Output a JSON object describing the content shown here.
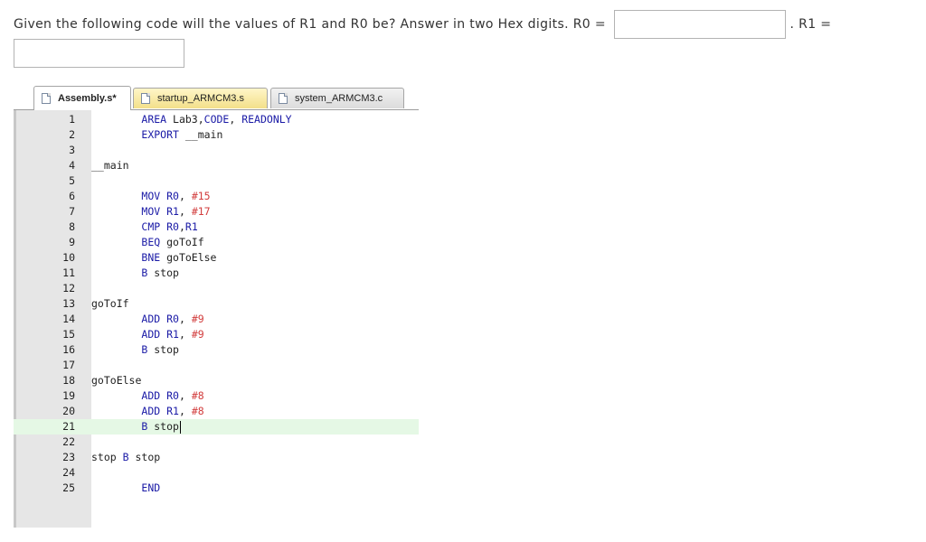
{
  "question": {
    "text_before": "Given the following code will the values of R1 and R0 be? Answer in two Hex digits. R0 =",
    "separator": ".",
    "r1_label": "R1 =",
    "r0_value": "",
    "r1_value": ""
  },
  "editor": {
    "tabs": [
      {
        "label": "Assembly.s*",
        "active": true
      },
      {
        "label": "startup_ARMCM3.s",
        "active": false
      },
      {
        "label": "system_ARMCM3.c",
        "active": false
      }
    ],
    "current_line": 21,
    "lines": [
      {
        "n": "1",
        "tokens": [
          [
            "        ",
            ""
          ],
          [
            "AREA",
            "kw"
          ],
          [
            " Lab3,",
            ""
          ],
          [
            "CODE",
            "kw"
          ],
          [
            ", ",
            ""
          ],
          [
            "READONLY",
            "kw"
          ]
        ]
      },
      {
        "n": "2",
        "tokens": [
          [
            "        ",
            ""
          ],
          [
            "EXPORT",
            "kw"
          ],
          [
            " __main",
            ""
          ]
        ]
      },
      {
        "n": "3",
        "tokens": []
      },
      {
        "n": "4",
        "tokens": [
          [
            "__main",
            ""
          ]
        ]
      },
      {
        "n": "5",
        "tokens": []
      },
      {
        "n": "6",
        "tokens": [
          [
            "        ",
            ""
          ],
          [
            "MOV",
            "kw"
          ],
          [
            " ",
            ""
          ],
          [
            "R0",
            "kw"
          ],
          [
            ", ",
            ""
          ],
          [
            "#15",
            "num"
          ]
        ]
      },
      {
        "n": "7",
        "tokens": [
          [
            "        ",
            ""
          ],
          [
            "MOV",
            "kw"
          ],
          [
            " ",
            ""
          ],
          [
            "R1",
            "kw"
          ],
          [
            ", ",
            ""
          ],
          [
            "#17",
            "num"
          ]
        ]
      },
      {
        "n": "8",
        "tokens": [
          [
            "        ",
            ""
          ],
          [
            "CMP",
            "kw"
          ],
          [
            " ",
            ""
          ],
          [
            "R0",
            "kw"
          ],
          [
            ",",
            ""
          ],
          [
            "R1",
            "kw"
          ]
        ]
      },
      {
        "n": "9",
        "tokens": [
          [
            "        ",
            ""
          ],
          [
            "BEQ",
            "kw"
          ],
          [
            " goToIf",
            ""
          ]
        ]
      },
      {
        "n": "10",
        "tokens": [
          [
            "        ",
            ""
          ],
          [
            "BNE",
            "kw"
          ],
          [
            " goToElse",
            ""
          ]
        ]
      },
      {
        "n": "11",
        "tokens": [
          [
            "        ",
            ""
          ],
          [
            "B",
            "kw"
          ],
          [
            " stop",
            ""
          ]
        ]
      },
      {
        "n": "12",
        "tokens": []
      },
      {
        "n": "13",
        "tokens": [
          [
            "goToIf",
            ""
          ]
        ]
      },
      {
        "n": "14",
        "tokens": [
          [
            "        ",
            ""
          ],
          [
            "ADD",
            "kw"
          ],
          [
            " ",
            ""
          ],
          [
            "R0",
            "kw"
          ],
          [
            ", ",
            ""
          ],
          [
            "#9",
            "num"
          ]
        ]
      },
      {
        "n": "15",
        "tokens": [
          [
            "        ",
            ""
          ],
          [
            "ADD",
            "kw"
          ],
          [
            " ",
            ""
          ],
          [
            "R1",
            "kw"
          ],
          [
            ", ",
            ""
          ],
          [
            "#9",
            "num"
          ]
        ]
      },
      {
        "n": "16",
        "tokens": [
          [
            "        ",
            ""
          ],
          [
            "B",
            "kw"
          ],
          [
            " stop",
            ""
          ]
        ]
      },
      {
        "n": "17",
        "tokens": []
      },
      {
        "n": "18",
        "tokens": [
          [
            "goToElse",
            ""
          ]
        ]
      },
      {
        "n": "19",
        "tokens": [
          [
            "        ",
            ""
          ],
          [
            "ADD",
            "kw"
          ],
          [
            " ",
            ""
          ],
          [
            "R0",
            "kw"
          ],
          [
            ", ",
            ""
          ],
          [
            "#8",
            "num"
          ]
        ]
      },
      {
        "n": "20",
        "tokens": [
          [
            "        ",
            ""
          ],
          [
            "ADD",
            "kw"
          ],
          [
            " ",
            ""
          ],
          [
            "R1",
            "kw"
          ],
          [
            ", ",
            ""
          ],
          [
            "#8",
            "num"
          ]
        ]
      },
      {
        "n": "21",
        "tokens": [
          [
            "        ",
            ""
          ],
          [
            "B",
            "kw"
          ],
          [
            " stop",
            ""
          ]
        ]
      },
      {
        "n": "22",
        "tokens": []
      },
      {
        "n": "23",
        "tokens": [
          [
            "stop ",
            ""
          ],
          [
            "B",
            "kw"
          ],
          [
            " stop",
            ""
          ]
        ]
      },
      {
        "n": "24",
        "tokens": []
      },
      {
        "n": "25",
        "tokens": [
          [
            "        ",
            ""
          ],
          [
            "END",
            "kw"
          ]
        ]
      }
    ]
  }
}
